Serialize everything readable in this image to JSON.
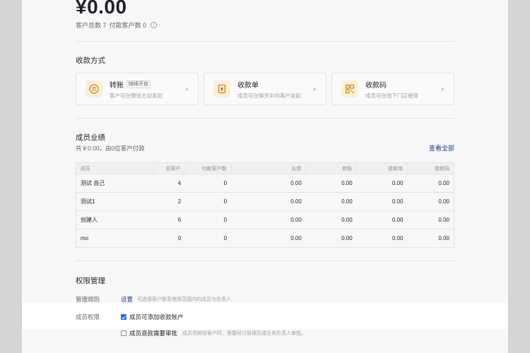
{
  "summary": {
    "amount": "¥0.00",
    "customer_total_label": "客户总数 7",
    "paying_customers_label": "付款客户数 0"
  },
  "payment_methods": {
    "title": "收款方式",
    "cards": [
      {
        "name": "转账",
        "badge": "随续开放",
        "desc": "客户可在微信主动发起",
        "icon": "transfer-icon"
      },
      {
        "name": "收款单",
        "badge": "",
        "desc": "成员可在聊天中向客户发起",
        "icon": "receipt-icon"
      },
      {
        "name": "收款码",
        "badge": "",
        "desc": "成员可在线下门店使用",
        "icon": "qr-code-icon"
      }
    ]
  },
  "performance": {
    "title": "成员业绩",
    "subtitle": "共￥0.00，由0位客户付款",
    "view_all": "查看全部",
    "columns": [
      "成员",
      "总客户",
      "付款客户数",
      "业绩",
      "转账",
      "收款单",
      "收款码"
    ],
    "rows": [
      [
        "测试 自己",
        "4",
        "0",
        "0.00",
        "0.00",
        "0.00",
        "0.00"
      ],
      [
        "测试1",
        "2",
        "0",
        "0.00",
        "0.00",
        "0.00",
        "0.00"
      ],
      [
        "创建人",
        "6",
        "0",
        "0.00",
        "0.00",
        "0.00",
        "0.00"
      ],
      [
        "mo",
        "0",
        "0",
        "0.00",
        "0.00",
        "0.00",
        "0.00"
      ]
    ]
  },
  "permissions": {
    "title": "权限管理",
    "rule_label": "管理规则",
    "rule_setting": "设置",
    "rule_hint": "可选择客户联系使用范围内的成员为负责人",
    "member_label": "成员权限",
    "option_add_account": "成员可添加收款账户",
    "option_add_account_checked": true,
    "option_refund": "成员退款需要审批",
    "option_refund_checked": false,
    "option_refund_hint": "成员退款给客户时，需要经过管理员或业务负责人审批。"
  }
}
